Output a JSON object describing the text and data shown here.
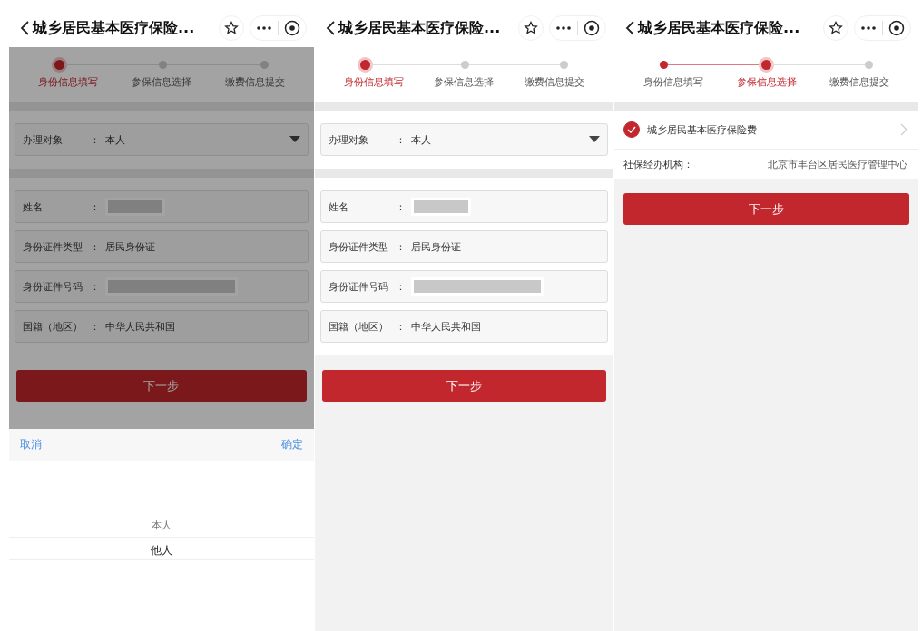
{
  "screens": [
    {
      "kind": "form",
      "dimmed": true,
      "title": "城乡居民基本医疗保险...",
      "steps": [
        {
          "label": "身份信息填写",
          "done": false,
          "current": true
        },
        {
          "label": "参保信息选择",
          "done": false,
          "current": false
        },
        {
          "label": "缴费信息提交",
          "done": false,
          "current": false
        }
      ],
      "select": {
        "label": "办理对象",
        "colon": "：",
        "value": "本人"
      },
      "fields": [
        {
          "label": "姓名",
          "colon": "：",
          "redacted": true
        },
        {
          "label": "身份证件类型",
          "colon": "：",
          "value": "居民身份证"
        },
        {
          "label": "身份证件号码",
          "colon": "：",
          "redacted": true
        },
        {
          "label": "国籍（地区）",
          "colon": "：",
          "value": "中华人民共和国"
        }
      ],
      "next_button": "下一步",
      "picker": {
        "cancel": "取消",
        "confirm": "确定",
        "options": [
          {
            "label": "本人",
            "selected": false
          },
          {
            "label": "他人",
            "selected": true
          }
        ]
      }
    },
    {
      "kind": "form",
      "dimmed": false,
      "title": "城乡居民基本医疗保险...",
      "steps": [
        {
          "label": "身份信息填写",
          "done": false,
          "current": true
        },
        {
          "label": "参保信息选择",
          "done": false,
          "current": false
        },
        {
          "label": "缴费信息提交",
          "done": false,
          "current": false
        }
      ],
      "select": {
        "label": "办理对象",
        "colon": "：",
        "value": "本人"
      },
      "fields": [
        {
          "label": "姓名",
          "colon": "：",
          "redacted": true
        },
        {
          "label": "身份证件类型",
          "colon": "：",
          "value": "居民身份证"
        },
        {
          "label": "身份证件号码",
          "colon": "：",
          "redacted": true
        },
        {
          "label": "国籍（地区）",
          "colon": "：",
          "value": "中华人民共和国"
        }
      ],
      "next_button": "下一步"
    },
    {
      "kind": "insurance",
      "title": "城乡居民基本医疗保险...",
      "steps": [
        {
          "label": "身份信息填写",
          "done": true,
          "current": false
        },
        {
          "label": "参保信息选择",
          "done": false,
          "current": true
        },
        {
          "label": "缴费信息提交",
          "done": false,
          "current": false
        }
      ],
      "item": {
        "label": "城乡居民基本医疗保险费",
        "checked": true
      },
      "agency": {
        "label": "社保经办机构：",
        "value": "北京市丰台区居民医疗管理中心"
      },
      "next_button": "下一步"
    }
  ]
}
